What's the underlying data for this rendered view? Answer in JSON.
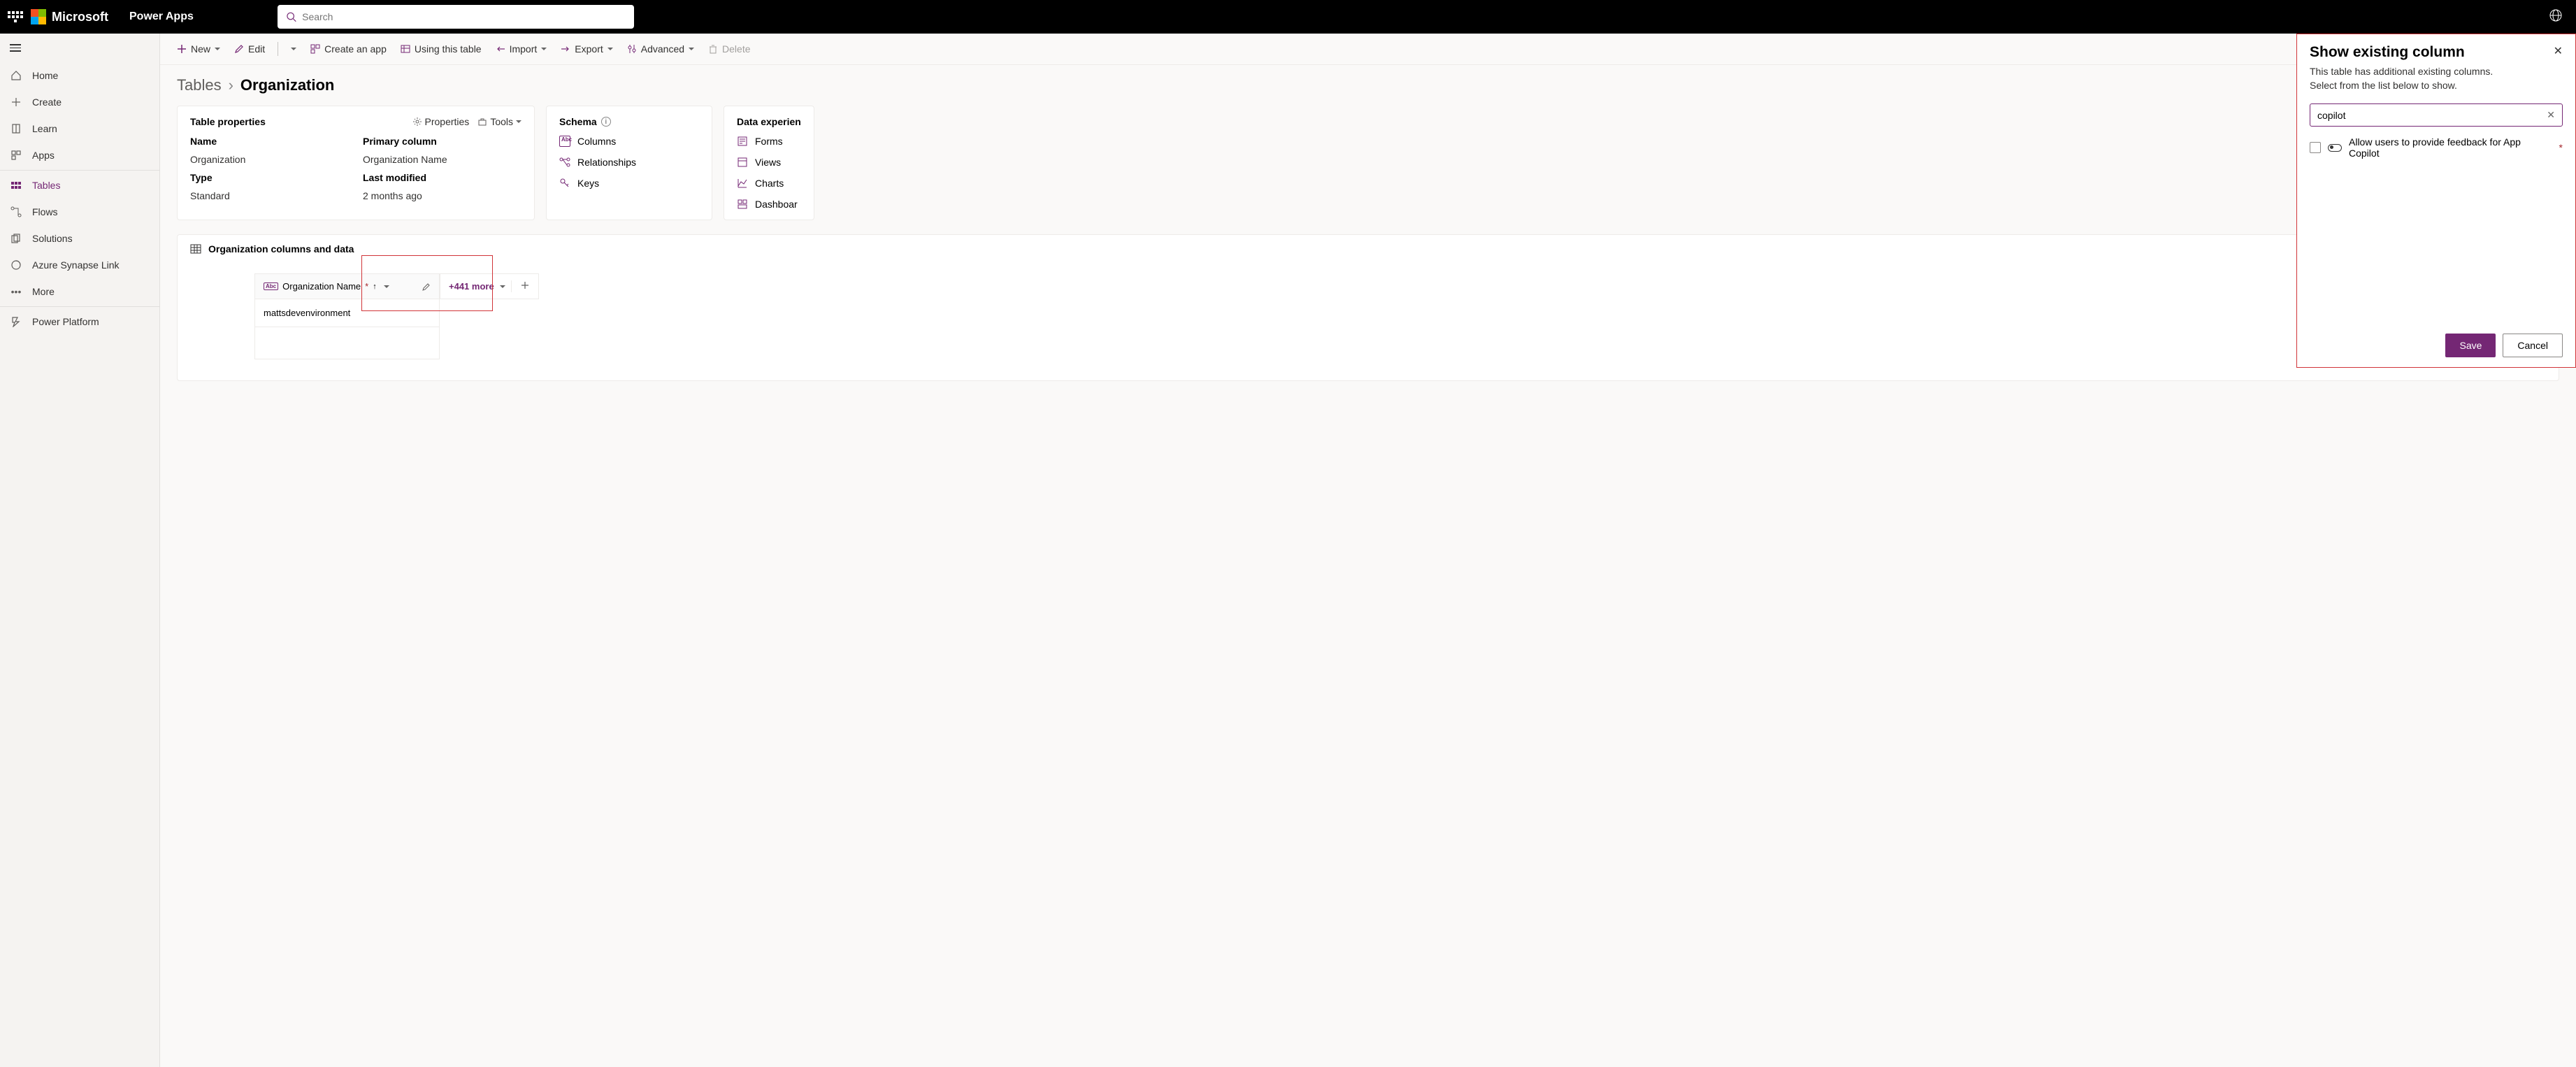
{
  "header": {
    "brand": "Microsoft",
    "app_name": "Power Apps",
    "search_placeholder": "Search"
  },
  "sidebar": {
    "items": [
      {
        "label": "Home"
      },
      {
        "label": "Create"
      },
      {
        "label": "Learn"
      },
      {
        "label": "Apps"
      },
      {
        "label": "Tables"
      },
      {
        "label": "Flows"
      },
      {
        "label": "Solutions"
      },
      {
        "label": "Azure Synapse Link"
      },
      {
        "label": "More"
      },
      {
        "label": "Power Platform"
      }
    ]
  },
  "cmdbar": {
    "new": "New",
    "edit": "Edit",
    "create_app": "Create an app",
    "using_table": "Using this table",
    "import": "Import",
    "export": "Export",
    "advanced": "Advanced",
    "delete": "Delete"
  },
  "breadcrumb": {
    "parent": "Tables",
    "current": "Organization"
  },
  "table_props": {
    "title": "Table properties",
    "properties_label": "Properties",
    "tools_label": "Tools",
    "name_label": "Name",
    "name_value": "Organization",
    "primary_label": "Primary column",
    "primary_value": "Organization Name",
    "type_label": "Type",
    "type_value": "Standard",
    "modified_label": "Last modified",
    "modified_value": "2 months ago"
  },
  "schema": {
    "title": "Schema",
    "columns": "Columns",
    "relationships": "Relationships",
    "keys": "Keys"
  },
  "data_exp": {
    "title": "Data experien",
    "forms": "Forms",
    "views": "Views",
    "charts": "Charts",
    "dashboards": "Dashboar"
  },
  "data_section": {
    "title": "Organization columns and data",
    "col1_name": "Organization Name",
    "more_count": "+441 more",
    "row1_value": "mattsdevenvironment"
  },
  "panel": {
    "title": "Show existing column",
    "desc1": "This table has additional existing columns.",
    "desc2": "Select from the list below to show.",
    "search_value": "copilot",
    "result_label": "Allow users to provide feedback for App Copilot",
    "save": "Save",
    "cancel": "Cancel"
  }
}
